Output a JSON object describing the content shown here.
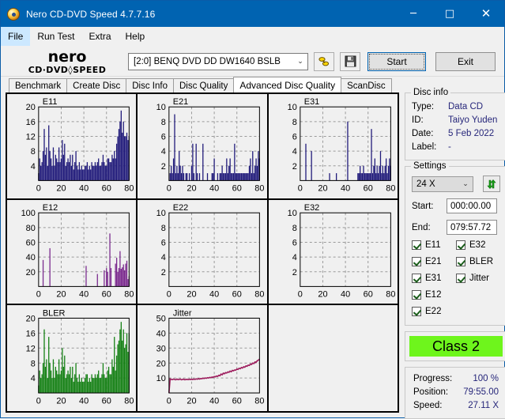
{
  "window": {
    "title": "Nero CD-DVD Speed 4.7.7.16",
    "icon": "nero-disc-icon",
    "minimize": "─",
    "maximize": "□",
    "close": "✕"
  },
  "menu": [
    {
      "label": "File",
      "accel": "F",
      "active": true
    },
    {
      "label": "Run Test",
      "accel": "R",
      "active": false
    },
    {
      "label": "Extra",
      "accel": "E",
      "active": false
    },
    {
      "label": "Help",
      "accel": "H",
      "active": false
    }
  ],
  "toolbar": {
    "logo_primary": "nero",
    "logo_secondary": "CD·DVD SPEED",
    "drive_value": "[2:0]   BENQ DVD DD DW1640 BSLB",
    "chevron": "⌄",
    "eject_icon": "eject-disc-icon",
    "save_icon": "floppy-save-icon",
    "start_label": "Start",
    "exit_label": "Exit"
  },
  "tabs": [
    {
      "label": "Benchmark",
      "selected": false
    },
    {
      "label": "Create Disc",
      "selected": false
    },
    {
      "label": "Disc Info",
      "selected": false
    },
    {
      "label": "Disc Quality",
      "selected": false
    },
    {
      "label": "Advanced Disc Quality",
      "selected": true
    },
    {
      "label": "ScanDisc",
      "selected": false
    }
  ],
  "disc_info": {
    "group_label": "Disc info",
    "type_key": "Type:",
    "type_value": "Data CD",
    "id_key": "ID:",
    "id_value": "Taiyo Yuden",
    "date_key": "Date:",
    "date_value": "5 Feb 2022",
    "label_key": "Label:",
    "label_value": "-"
  },
  "settings": {
    "group_label": "Settings",
    "speed_value": "24 X",
    "chevron": "⌄",
    "refresh_icon": "refresh-arrows-icon",
    "start_key": "Start:",
    "start_value": "000:00.00",
    "end_key": "End:",
    "end_value": "079:57.72",
    "checkboxes_left": [
      "E11",
      "E21",
      "E31",
      "E12",
      "E22"
    ],
    "checkboxes_right": [
      "E32",
      "BLER",
      "Jitter"
    ]
  },
  "class_badge": {
    "label": "Class 2",
    "color": "#6ef51c"
  },
  "status": {
    "progress_key": "Progress:",
    "progress_value": "100 %",
    "position_key": "Position:",
    "position_value": "79:55.00",
    "speed_key": "Speed:",
    "speed_value": "27.11 X"
  },
  "colors": {
    "accent": "#0063b1",
    "e1x_blue": "#201a7a",
    "e12_purple": "#7b2a8e",
    "bler_green": "#148014",
    "jitter_magenta": "#9e1e5e",
    "class_green": "#6ef51c",
    "value_text": "#26267a"
  },
  "chart_data": [
    {
      "id": "E11",
      "type": "area",
      "title": "E11",
      "xlabel": "",
      "ylabel": "",
      "xlim": [
        0,
        80
      ],
      "ylim": [
        0,
        20
      ],
      "grid": true,
      "xticks": [
        0,
        20,
        40,
        60,
        80
      ],
      "yticks": [
        4,
        8,
        12,
        16,
        20
      ],
      "color": "#201a7a",
      "x": [
        0,
        1,
        2,
        3,
        4,
        5,
        6,
        7,
        8,
        9,
        10,
        11,
        12,
        13,
        14,
        15,
        16,
        17,
        18,
        19,
        20,
        21,
        22,
        23,
        24,
        25,
        26,
        27,
        28,
        29,
        30,
        31,
        32,
        33,
        34,
        35,
        36,
        37,
        38,
        39,
        40,
        41,
        42,
        43,
        44,
        45,
        46,
        47,
        48,
        49,
        50,
        51,
        52,
        53,
        54,
        55,
        56,
        57,
        58,
        59,
        60,
        61,
        62,
        63,
        64,
        65,
        66,
        67,
        68,
        69,
        70,
        71,
        72,
        73,
        74,
        75,
        76,
        77,
        78,
        79,
        80
      ],
      "values": [
        2,
        6,
        4,
        5,
        8,
        14,
        7,
        9,
        4,
        15,
        8,
        6,
        4,
        9,
        4,
        7,
        6,
        5,
        9,
        5,
        6,
        11,
        7,
        10,
        4,
        5,
        6,
        5,
        7,
        4,
        7,
        3,
        5,
        8,
        4,
        3,
        5,
        3,
        4,
        3,
        3,
        4,
        4,
        5,
        3,
        4,
        3,
        5,
        4,
        4,
        5,
        4,
        5,
        6,
        4,
        4,
        5,
        7,
        5,
        4,
        4,
        6,
        6,
        5,
        5,
        7,
        6,
        8,
        6,
        10,
        12,
        14,
        16,
        19,
        13,
        16,
        12,
        12,
        13,
        11,
        12
      ]
    },
    {
      "id": "E21",
      "type": "area",
      "title": "E21",
      "xlim": [
        0,
        80
      ],
      "ylim": [
        0,
        10
      ],
      "grid": true,
      "xticks": [
        0,
        20,
        40,
        60,
        80
      ],
      "yticks": [
        2,
        4,
        6,
        8,
        10
      ],
      "color": "#201a7a",
      "x": [
        0,
        1,
        2,
        3,
        4,
        5,
        6,
        7,
        8,
        9,
        10,
        11,
        12,
        13,
        14,
        15,
        16,
        17,
        18,
        19,
        20,
        21,
        22,
        23,
        24,
        25,
        26,
        27,
        28,
        29,
        30,
        31,
        32,
        33,
        34,
        35,
        36,
        37,
        38,
        39,
        40,
        41,
        42,
        43,
        44,
        45,
        46,
        47,
        48,
        49,
        50,
        51,
        52,
        53,
        54,
        55,
        56,
        57,
        58,
        59,
        60,
        61,
        62,
        63,
        64,
        65,
        66,
        67,
        68,
        69,
        70,
        71,
        72,
        73,
        74,
        75,
        76,
        77,
        78,
        79,
        80
      ],
      "values": [
        0,
        1,
        2,
        1,
        3,
        9,
        1,
        2,
        1,
        4,
        2,
        1,
        2,
        1,
        0,
        1,
        1,
        0,
        1,
        0,
        2,
        5,
        1,
        0,
        5,
        1,
        0,
        1,
        0,
        0,
        5,
        0,
        0,
        0,
        1,
        0,
        0,
        0,
        1,
        1,
        3,
        0,
        0,
        1,
        0,
        1,
        1,
        2,
        1,
        1,
        1,
        3,
        1,
        2,
        3,
        1,
        1,
        1,
        5,
        1,
        1,
        1,
        1,
        1,
        1,
        1,
        1,
        1,
        1,
        1,
        1,
        2,
        3,
        1,
        4,
        1,
        2,
        3,
        2,
        4,
        3
      ]
    },
    {
      "id": "E31",
      "type": "area",
      "title": "E31",
      "xlim": [
        0,
        80
      ],
      "ylim": [
        0,
        10
      ],
      "grid": true,
      "xticks": [
        0,
        20,
        40,
        60,
        80
      ],
      "yticks": [
        2,
        4,
        6,
        8,
        10
      ],
      "color": "#201a7a",
      "x": [
        0,
        1,
        2,
        3,
        4,
        5,
        6,
        7,
        8,
        9,
        10,
        11,
        12,
        13,
        14,
        15,
        16,
        17,
        18,
        19,
        20,
        21,
        22,
        23,
        24,
        25,
        26,
        27,
        28,
        29,
        30,
        31,
        32,
        33,
        34,
        35,
        36,
        37,
        38,
        39,
        40,
        41,
        42,
        43,
        44,
        45,
        46,
        47,
        48,
        49,
        50,
        51,
        52,
        53,
        54,
        55,
        56,
        57,
        58,
        59,
        60,
        61,
        62,
        63,
        64,
        65,
        66,
        67,
        68,
        69,
        70,
        71,
        72,
        73,
        74,
        75,
        76,
        77,
        78,
        79,
        80
      ],
      "values": [
        0,
        0,
        0,
        0,
        0,
        5,
        0,
        0,
        0,
        0,
        4,
        0,
        0,
        0,
        0,
        0,
        0,
        0,
        0,
        0,
        0,
        0,
        0,
        0,
        0,
        0,
        1,
        0,
        0,
        0,
        0,
        0,
        1,
        0,
        0,
        0,
        0,
        0,
        0,
        0,
        0,
        0,
        8,
        0,
        0,
        0,
        0,
        0,
        0,
        0,
        0,
        1,
        1,
        2,
        1,
        1,
        2,
        1,
        1,
        1,
        1,
        1,
        1,
        7,
        1,
        2,
        3,
        1,
        2,
        1,
        2,
        4,
        1,
        2,
        1,
        2,
        3,
        1,
        2,
        3,
        2
      ]
    },
    {
      "id": "E12",
      "type": "area",
      "title": "E12",
      "xlim": [
        0,
        80
      ],
      "ylim": [
        0,
        100
      ],
      "grid": true,
      "xticks": [
        0,
        20,
        40,
        60,
        80
      ],
      "yticks": [
        20,
        40,
        60,
        80,
        100
      ],
      "color": "#7b2a8e",
      "x": [
        0,
        1,
        2,
        3,
        4,
        5,
        6,
        7,
        8,
        9,
        10,
        11,
        12,
        13,
        14,
        15,
        16,
        17,
        18,
        19,
        20,
        21,
        22,
        23,
        24,
        25,
        26,
        27,
        28,
        29,
        30,
        31,
        32,
        33,
        34,
        35,
        36,
        37,
        38,
        39,
        40,
        41,
        42,
        43,
        44,
        45,
        46,
        47,
        48,
        49,
        50,
        51,
        52,
        53,
        54,
        55,
        56,
        57,
        58,
        59,
        60,
        61,
        62,
        63,
        64,
        65,
        66,
        67,
        68,
        69,
        70,
        71,
        72,
        73,
        74,
        75,
        76,
        77,
        78,
        79,
        80
      ],
      "values": [
        0,
        0,
        0,
        0,
        36,
        0,
        0,
        0,
        0,
        0,
        52,
        0,
        0,
        0,
        0,
        0,
        0,
        0,
        0,
        0,
        0,
        0,
        0,
        0,
        0,
        0,
        0,
        0,
        0,
        0,
        0,
        0,
        0,
        0,
        0,
        0,
        0,
        0,
        0,
        0,
        0,
        0,
        28,
        0,
        0,
        0,
        0,
        0,
        0,
        0,
        0,
        0,
        17,
        0,
        0,
        0,
        0,
        0,
        22,
        0,
        25,
        20,
        0,
        72,
        25,
        0,
        0,
        0,
        31,
        39,
        20,
        25,
        48,
        24,
        26,
        30,
        22,
        31,
        35,
        10,
        14
      ]
    },
    {
      "id": "E22",
      "type": "area",
      "title": "E22",
      "xlim": [
        0,
        80
      ],
      "ylim": [
        0,
        10
      ],
      "grid": true,
      "xticks": [
        0,
        20,
        40,
        60,
        80
      ],
      "yticks": [
        2,
        4,
        6,
        8,
        10
      ],
      "color": "#201a7a",
      "x": [],
      "values": []
    },
    {
      "id": "E32",
      "type": "area",
      "title": "E32",
      "xlim": [
        0,
        80
      ],
      "ylim": [
        0,
        10
      ],
      "grid": true,
      "xticks": [
        0,
        20,
        40,
        60,
        80
      ],
      "yticks": [
        2,
        4,
        6,
        8,
        10
      ],
      "color": "#201a7a",
      "x": [],
      "values": []
    },
    {
      "id": "BLER",
      "type": "area",
      "title": "BLER",
      "xlim": [
        0,
        80
      ],
      "ylim": [
        0,
        20
      ],
      "grid": true,
      "xticks": [
        0,
        20,
        40,
        60,
        80
      ],
      "yticks": [
        4,
        8,
        12,
        16,
        20
      ],
      "color": "#148014",
      "x": [
        0,
        1,
        2,
        3,
        4,
        5,
        6,
        7,
        8,
        9,
        10,
        11,
        12,
        13,
        14,
        15,
        16,
        17,
        18,
        19,
        20,
        21,
        22,
        23,
        24,
        25,
        26,
        27,
        28,
        29,
        30,
        31,
        32,
        33,
        34,
        35,
        36,
        37,
        38,
        39,
        40,
        41,
        42,
        43,
        44,
        45,
        46,
        47,
        48,
        49,
        50,
        51,
        52,
        53,
        54,
        55,
        56,
        57,
        58,
        59,
        60,
        61,
        62,
        63,
        64,
        65,
        66,
        67,
        68,
        69,
        70,
        71,
        72,
        73,
        74,
        75,
        76,
        77,
        78,
        79,
        80
      ],
      "values": [
        2,
        6,
        4,
        5,
        8,
        17,
        7,
        9,
        4,
        15,
        8,
        6,
        4,
        9,
        4,
        7,
        6,
        5,
        9,
        5,
        6,
        12,
        7,
        10,
        4,
        5,
        6,
        5,
        7,
        4,
        7,
        3,
        5,
        8,
        4,
        3,
        5,
        3,
        4,
        3,
        3,
        4,
        5,
        5,
        3,
        4,
        3,
        5,
        4,
        4,
        5,
        4,
        5,
        6,
        4,
        4,
        5,
        8,
        5,
        4,
        4,
        6,
        7,
        5,
        5,
        9,
        7,
        15,
        6,
        10,
        13,
        14,
        17,
        19,
        14,
        17,
        12,
        13,
        16,
        11,
        16
      ]
    },
    {
      "id": "Jitter",
      "type": "line",
      "title": "Jitter",
      "xlim": [
        0,
        80
      ],
      "ylim": [
        0,
        50
      ],
      "grid": true,
      "xticks": [
        0,
        20,
        40,
        60,
        80
      ],
      "yticks": [
        10,
        20,
        30,
        40,
        50
      ],
      "color": "#9e1e5e",
      "x": [
        0,
        1,
        2,
        3,
        4,
        5,
        6,
        7,
        8,
        9,
        10,
        11,
        12,
        13,
        14,
        15,
        16,
        17,
        18,
        19,
        20,
        21,
        22,
        23,
        24,
        25,
        26,
        27,
        28,
        29,
        30,
        31,
        32,
        33,
        34,
        35,
        36,
        37,
        38,
        39,
        40,
        41,
        42,
        43,
        44,
        45,
        46,
        47,
        48,
        49,
        50,
        51,
        52,
        53,
        54,
        55,
        56,
        57,
        58,
        59,
        60,
        61,
        62,
        63,
        64,
        65,
        66,
        67,
        68,
        69,
        70,
        71,
        72,
        73,
        74,
        75,
        76,
        77,
        78,
        79,
        80
      ],
      "values": [
        0,
        9.4,
        9.0,
        8.9,
        9.3,
        9.0,
        8.8,
        9.3,
        8.9,
        9.0,
        9.3,
        8.8,
        9.0,
        9.2,
        8.8,
        9.0,
        9.1,
        8.9,
        9.2,
        9.0,
        9.2,
        9.0,
        9.3,
        9.1,
        9.4,
        9.2,
        9.5,
        9.3,
        9.6,
        9.5,
        9.9,
        9.7,
        10.0,
        9.8,
        10.2,
        10.0,
        10.4,
        10.2,
        10.6,
        10.5,
        10.9,
        10.8,
        11.3,
        11.1,
        11.8,
        11.5,
        12.6,
        12.2,
        13.2,
        12.8,
        13.6,
        13.3,
        14.1,
        13.8,
        14.6,
        14.2,
        15.1,
        14.8,
        15.4,
        15.2,
        16.0,
        15.7,
        16.5,
        16.2,
        17.0,
        16.7,
        17.5,
        17.2,
        18.1,
        17.8,
        18.6,
        18.4,
        19.3,
        19.0,
        20.0,
        19.7,
        20.7,
        20.5,
        21.5,
        21.9,
        22.6
      ]
    }
  ]
}
